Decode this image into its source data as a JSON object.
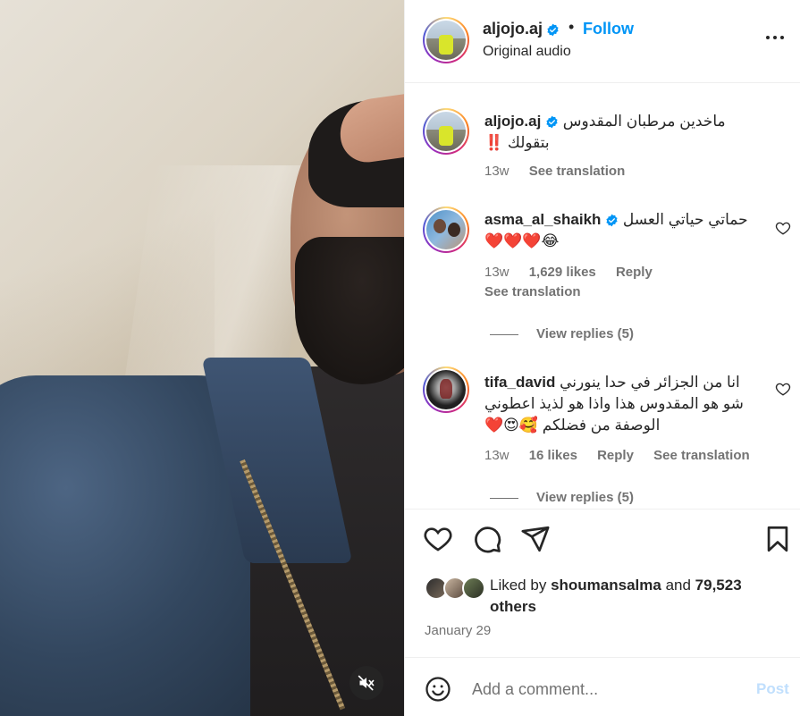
{
  "media": {
    "mute_icon": "speaker-muted-icon"
  },
  "header": {
    "username": "aljojo.aj",
    "separator": "•",
    "follow_label": "Follow",
    "subtitle": "Original audio",
    "more_icon": "more-horizontal-icon"
  },
  "caption": {
    "username": "aljojo.aj",
    "text": "ماخدين مرطبان المقدوس بتقولك ‼️",
    "time": "13w",
    "see_translation": "See translation"
  },
  "comments": [
    {
      "username": "asma_al_shaikh",
      "verified": true,
      "text": "حماتي حياتي العسل😂❤️❤️❤️",
      "time": "13w",
      "likes": "1,629 likes",
      "reply": "Reply",
      "see_translation": "See translation",
      "view_replies": "View replies (5)"
    },
    {
      "username": "tifa_david",
      "verified": false,
      "text": "انا من الجزائر في حدا ينورني شو هو المقدوس هذا واذا هو لذيذ اعطوني الوصفة من فضلكم 🥰😍❤️",
      "time": "13w",
      "likes": "16 likes",
      "reply": "Reply",
      "see_translation": "See translation",
      "view_replies": "View replies (5)"
    }
  ],
  "actions": {
    "like_icon": "heart-icon",
    "comment_icon": "comment-icon",
    "share_icon": "send-icon",
    "save_icon": "bookmark-icon"
  },
  "likes": {
    "prefix": "Liked by",
    "user": "shoumansalma",
    "and": "and",
    "count": "79,523",
    "suffix": "others"
  },
  "date": "January 29",
  "add_comment": {
    "placeholder": "Add a comment...",
    "post_label": "Post",
    "emoji_icon": "smiley-icon"
  },
  "colors": {
    "accent": "#0095f6",
    "verified": "#0095f6",
    "muted_text": "#737373",
    "post_disabled": "#c0dffd"
  }
}
